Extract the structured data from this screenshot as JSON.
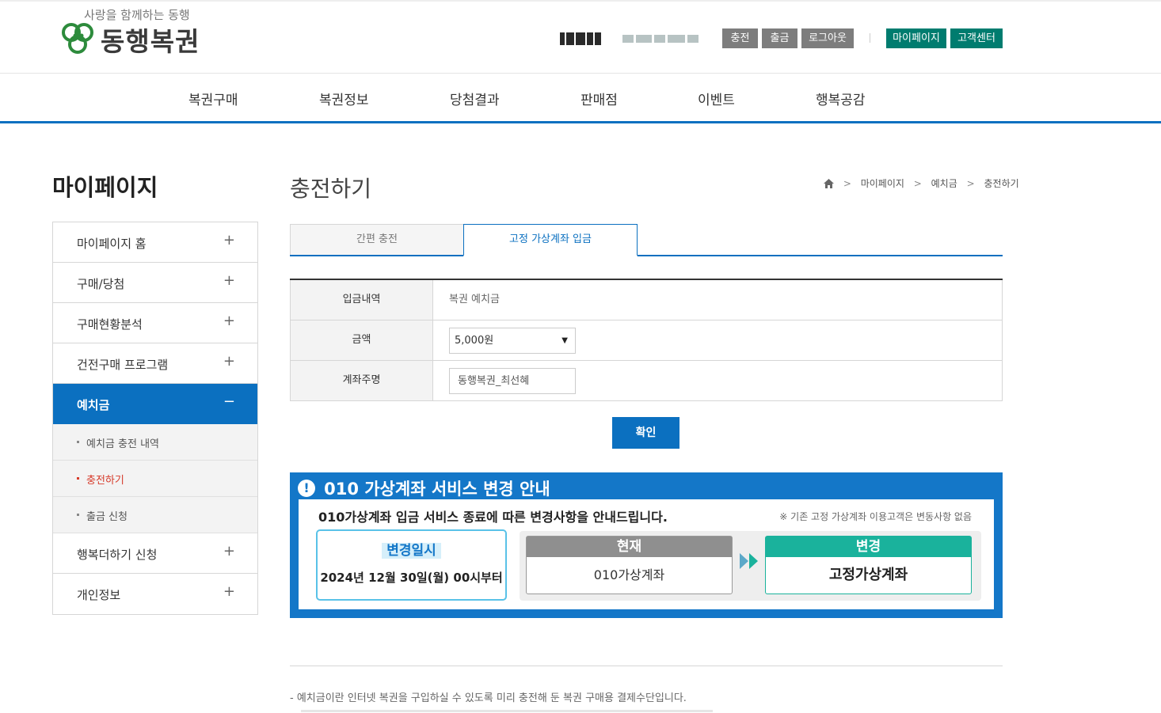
{
  "logo": {
    "tagline": "사랑을 함께하는 동행",
    "name": "동행복권"
  },
  "header": {
    "buttons": {
      "charge": "충전",
      "withdraw": "출금",
      "logout": "로그아웃",
      "mypage": "마이페이지",
      "support": "고객센터"
    }
  },
  "gnb": [
    "복권구매",
    "복권정보",
    "당첨결과",
    "판매점",
    "이벤트",
    "행복공감"
  ],
  "sidebar": {
    "title": "마이페이지",
    "items": [
      {
        "label": "마이페이지 홈",
        "toggle": "+"
      },
      {
        "label": "구매/당첨",
        "toggle": "+"
      },
      {
        "label": "구매현황분석",
        "toggle": "+"
      },
      {
        "label": "건전구매 프로그램",
        "toggle": "+"
      },
      {
        "label": "예치금",
        "toggle": "−"
      },
      {
        "label": "행복더하기 신청",
        "toggle": "+"
      },
      {
        "label": "개인정보",
        "toggle": "+"
      }
    ],
    "subitems": [
      "예치금 충전 내역",
      "충전하기",
      "출금 신청"
    ]
  },
  "page": {
    "title": "충전하기",
    "breadcrumb": [
      "마이페이지",
      "예치금",
      "충전하기"
    ]
  },
  "tabs": [
    "간편 충전",
    "고정 가상계좌 입금"
  ],
  "form": {
    "deposit_label": "입금내역",
    "deposit_value": "복권 예치금",
    "amount_label": "금액",
    "amount_value": "5,000원",
    "holder_label": "계좌주명",
    "holder_value": "동행복권_최선혜"
  },
  "confirm_label": "확인",
  "notice": {
    "title": "010 가상계좌 서비스 변경 안내",
    "subtitle": "010가상계좌 입금 서비스 종료에 따른 변경사항을 안내드립니다.",
    "note": "※ 기존 고정 가상계좌 이용고객은 변동사항 없음",
    "date_label": "변경일시",
    "date_value": "2024년 12월 30일(월) 00시부터",
    "current_label": "현재",
    "current_value": "010가상계좌",
    "change_label": "변경",
    "change_value": "고정가상계좌"
  },
  "footer_note": "-  예치금이란 인터넷 복권을 구입하실 수 있도록 미리 충전해 둔 복권 구매용 결제수단입니다.",
  "colors": {
    "primary": "#0b70c0",
    "accent_green": "#007c6f",
    "teal": "#1ab29c",
    "highlight": "#d63a2a"
  }
}
